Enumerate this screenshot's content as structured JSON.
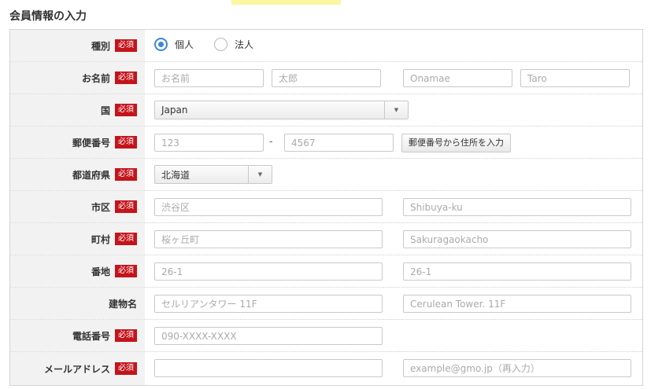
{
  "page": {
    "title": "会員情報の入力"
  },
  "required_badge": "必須",
  "rows": {
    "type": {
      "label": "種別",
      "options": [
        {
          "label": "個人",
          "checked": true
        },
        {
          "label": "法人",
          "checked": false
        }
      ]
    },
    "name": {
      "label": "お名前",
      "last_name_placeholder": "お名前",
      "first_name_placeholder": "太郎",
      "last_name_roman_placeholder": "Onamae",
      "first_name_roman_placeholder": "Taro"
    },
    "country": {
      "label": "国",
      "value": "Japan"
    },
    "postal": {
      "label": "郵便番号",
      "part1_placeholder": "123",
      "separator": "-",
      "part2_placeholder": "4567",
      "lookup_button": "郵便番号から住所を入力"
    },
    "prefecture": {
      "label": "都道府県",
      "value": "北海道"
    },
    "city": {
      "label": "市区",
      "placeholder": "渋谷区",
      "roman_placeholder": "Shibuya-ku"
    },
    "town": {
      "label": "町村",
      "placeholder": "桜ヶ丘町",
      "roman_placeholder": "Sakuragaokacho"
    },
    "street": {
      "label": "番地",
      "placeholder": "26-1",
      "roman_placeholder": "26-1"
    },
    "building": {
      "label": "建物名",
      "placeholder": "セルリアンタワー 11F",
      "roman_placeholder": "Cerulean Tower. 11F"
    },
    "phone": {
      "label": "電話番号",
      "placeholder": "090-XXXX-XXXX"
    },
    "email": {
      "label": "メールアドレス",
      "placeholder": "",
      "confirm_placeholder": "example@gmo.jp（再入力）"
    }
  },
  "colors": {
    "required": "#c4141b",
    "radio_accent": "#3b87d8",
    "label_bg": "#f2f2f2",
    "highlight": "#fbf6a0"
  }
}
